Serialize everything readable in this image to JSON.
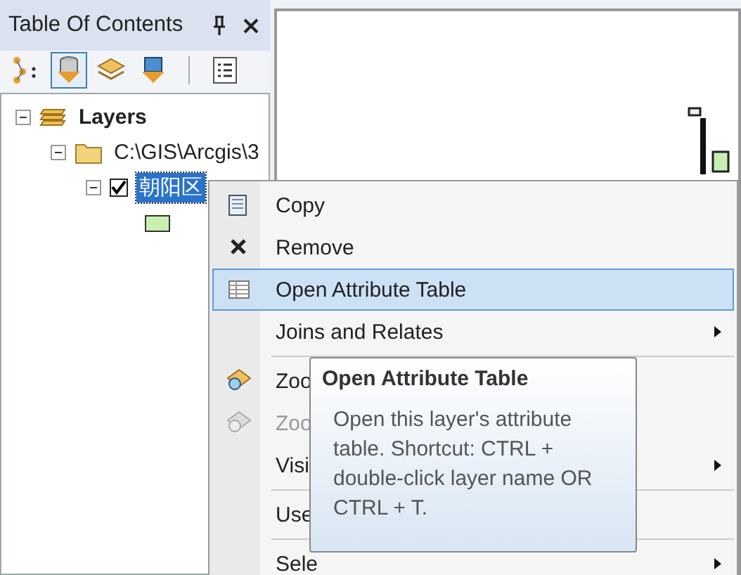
{
  "panel": {
    "title": "Table Of Contents",
    "toolbar": [
      {
        "selected": false
      },
      {
        "selected": true
      },
      {
        "selected": false
      },
      {
        "selected": false
      },
      {
        "selected": false
      }
    ],
    "tree": [
      {
        "label": "Layers",
        "expanded": true,
        "children": [
          {
            "label": "C:\\GIS\\Arcgis\\3",
            "expanded": true,
            "children": [
              {
                "label": "朝阳区",
                "checked": true,
                "selected": true,
                "expanded": true,
                "children": [
                  {
                    "kind": "symbol"
                  }
                ]
              }
            ]
          }
        ]
      }
    ]
  },
  "context_menu": [
    {
      "kind": "item",
      "label": "Copy",
      "disabled": false,
      "selected": false,
      "submenu": false
    },
    {
      "kind": "item",
      "label": "Remove",
      "disabled": false,
      "selected": false,
      "submenu": false
    },
    {
      "kind": "item",
      "label": "Open Attribute Table",
      "disabled": false,
      "selected": true,
      "submenu": false
    },
    {
      "kind": "item",
      "label": "Joins and Relates",
      "disabled": false,
      "selected": false,
      "submenu": true
    },
    {
      "kind": "separator"
    },
    {
      "kind": "item",
      "label": "Zoo",
      "disabled": false,
      "selected": false,
      "submenu": false
    },
    {
      "kind": "item",
      "label": "Zoo",
      "disabled": true,
      "selected": false,
      "submenu": false
    },
    {
      "kind": "item",
      "label": "Visi",
      "disabled": false,
      "selected": false,
      "submenu": true
    },
    {
      "kind": "separator"
    },
    {
      "kind": "item",
      "label": "Use",
      "disabled": false,
      "selected": false,
      "submenu": false
    },
    {
      "kind": "separator"
    },
    {
      "kind": "item",
      "label": "Sele",
      "disabled": false,
      "selected": false,
      "submenu": true
    }
  ],
  "tooltip": {
    "title": "Open Attribute Table",
    "text": "Open this layer's attribute table. Shortcut: CTRL + double-click layer name OR CTRL + T."
  }
}
